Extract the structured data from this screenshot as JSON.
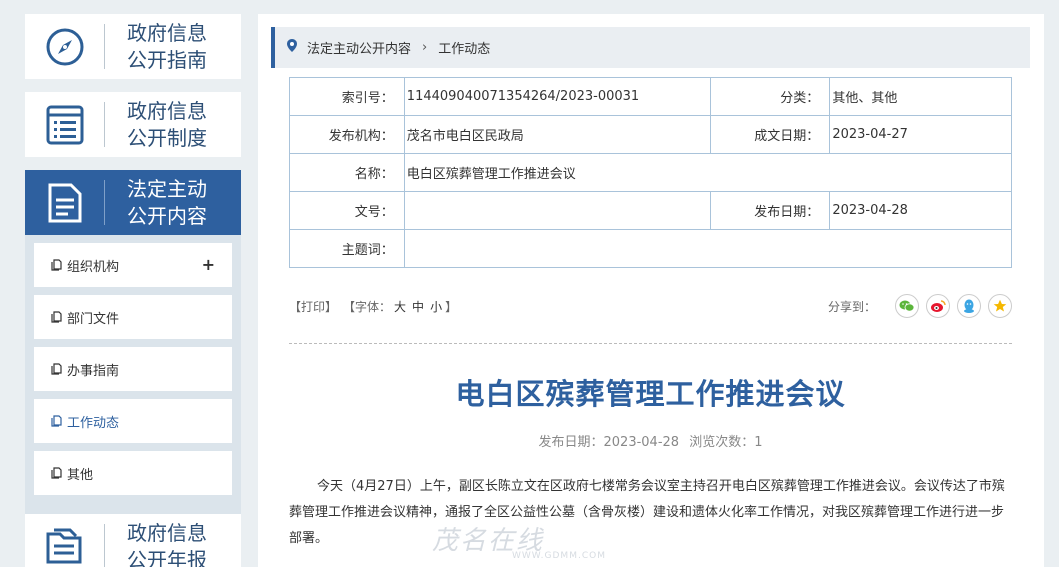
{
  "sidebar": {
    "blocks": [
      {
        "label": "政府信息\n公开指南",
        "icon": "compass-icon"
      },
      {
        "label": "政府信息\n公开制度",
        "icon": "list-icon"
      },
      {
        "label": "法定主动\n公开内容",
        "icon": "document-icon"
      },
      {
        "label": "政府信息\n公开年报",
        "icon": "folder-icon"
      }
    ],
    "submenu": [
      {
        "label": "组织机构",
        "expand": "+"
      },
      {
        "label": "部门文件"
      },
      {
        "label": "办事指南"
      },
      {
        "label": "工作动态"
      },
      {
        "label": "其他"
      }
    ]
  },
  "breadcrumb": {
    "items": [
      "法定主动公开内容",
      "工作动态"
    ],
    "separator": "›"
  },
  "meta": {
    "index_key": "索引号：",
    "index_val": "114409040071354264/2023-00031",
    "category_key": "分类：",
    "category_val": "其他、其他",
    "publisher_key": "发布机构：",
    "publisher_val": "茂名市电白区民政局",
    "created_key": "成文日期：",
    "created_val": "2023-04-27",
    "name_key": "名称：",
    "name_val": "电白区殡葬管理工作推进会议",
    "docno_key": "文号：",
    "docno_val": "",
    "pubdate_key": "发布日期：",
    "pubdate_val": "2023-04-28",
    "subject_key": "主题词：",
    "subject_val": ""
  },
  "tools": {
    "print": "【打印】",
    "font_prefix": "【字体：",
    "font_large": "大",
    "font_mid": "中",
    "font_small": "小",
    "font_suffix": "】",
    "share_label": "分享到："
  },
  "article": {
    "title": "电白区殡葬管理工作推进会议",
    "date_info": "发布日期：2023-04-28",
    "views_info": "浏览次数：1",
    "body": "今天（4月27日）上午，副区长陈立文在区政府七楼常务会议室主持召开电白区殡葬管理工作推进会议。会议传达了市殡葬管理工作推进会议精神，通报了全区公益性公墓（含骨灰楼）建设和遗体火化率工作情况，对我区殡葬管理工作进行进一步部署。"
  },
  "watermark": {
    "main": "茂名在线",
    "sub": "WWW.GDMM.COM"
  },
  "colors": {
    "accent": "#2e609f",
    "border": "#a9c3da",
    "background": "#eaeff2"
  }
}
